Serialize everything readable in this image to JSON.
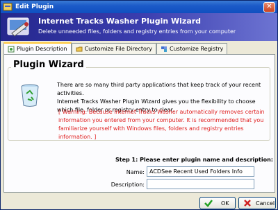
{
  "window": {
    "title": "Edit Plugin"
  },
  "banner": {
    "title": "Internet Tracks Washer Plugin Wizard",
    "subtitle": "Delete unneeded files, folders and registry entries from your computer"
  },
  "tabs": [
    {
      "label": "Plugin Description",
      "active": true
    },
    {
      "label": "Customize File Directory",
      "active": false
    },
    {
      "label": "Customize Registry",
      "active": false
    }
  ],
  "panel": {
    "group_title": "Plugin Wizard",
    "description_lines": [
      "There are so many third party applications that keep track of your recent activities.",
      "Internet Tracks Washer Plugin Wizard gives you the flexibility to choose",
      "which file, folder or registry entry to clear."
    ],
    "warning_lines": [
      "[ Warning: Because Internet Tracks Washer automatically removes certain",
      "information you entered from your computer. It is recommended that you",
      "familiarize yourself with Windows files, folders and registry entries information. ]"
    ],
    "step_label": "Step 1:  Please enter plugin name and description:",
    "name_label": "Name:",
    "name_value": "ACDSee Recent Used Folders Info",
    "description_label": "Description:",
    "description_value": ""
  },
  "buttons": {
    "ok": "OK",
    "cancel": "Cancel"
  },
  "colors": {
    "warning": "#e02020",
    "banner": "#25278d",
    "title_bar": "#1c5bc8"
  }
}
